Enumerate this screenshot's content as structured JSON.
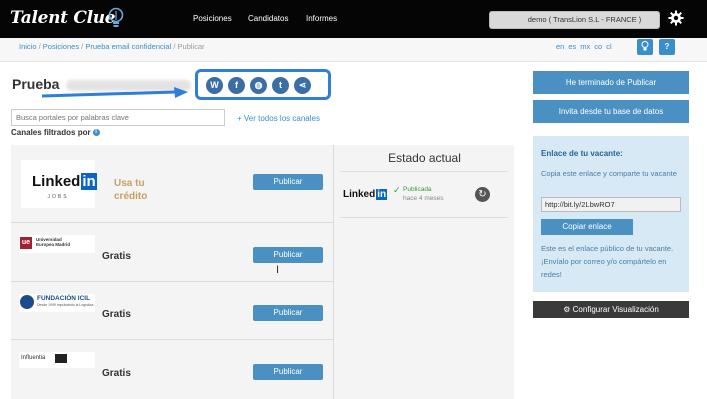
{
  "app": {
    "logo_text": "Talent Clue"
  },
  "nav": {
    "items": [
      "Posiciones",
      "Candidatos",
      "Informes"
    ]
  },
  "account": {
    "label": "demo ( TransLion S.L - FRANCE )"
  },
  "breadcrumb": {
    "items": [
      "Inicio",
      "Posiciones",
      "Prueba email confidencial"
    ],
    "current": "Publicar",
    "separator": "/"
  },
  "languages": [
    "en",
    "es",
    "mx",
    "co",
    "cl"
  ],
  "help_buttons": {
    "bulb": "💡",
    "question": "?"
  },
  "page": {
    "title": "Prueba"
  },
  "share": {
    "icons": [
      {
        "name": "wordpress-icon",
        "glyph": "W"
      },
      {
        "name": "facebook-icon",
        "glyph": "f"
      },
      {
        "name": "globe-icon",
        "glyph": "◍"
      },
      {
        "name": "twitter-icon",
        "glyph": "t"
      },
      {
        "name": "share-icon",
        "glyph": "⋖"
      }
    ]
  },
  "search": {
    "placeholder": "Busca portales por palabras clave"
  },
  "ver_todos": "Ver todos los canales",
  "filtrados_label": "Canales filtrados por",
  "channels": [
    {
      "logo": "LinkedIn",
      "logo_sub": "JOBS",
      "text": "Usa tu crédito",
      "button": "Publicar"
    },
    {
      "logo": "Universidad Europea Madrid",
      "text": "Gratis",
      "button": "Publicar"
    },
    {
      "logo": "FUNDACIÓN ICIL",
      "logo_sub": "Desde 1999 impulsando la Logística",
      "text": "Gratis",
      "button": "Publicar"
    },
    {
      "logo": "Influentia",
      "text": "Gratis",
      "button": "Publicar"
    }
  ],
  "estado": {
    "title": "Estado actual",
    "item": {
      "logo": "Linked",
      "logo_in": "in",
      "status": "Publicada",
      "when": "hace 4 meses"
    }
  },
  "right": {
    "btn_terminado": "He terminado de Publicar",
    "btn_invita": "Invita desde tu base de datos",
    "enlace_title": "Enlace de tu vacante:",
    "enlace_copy": "Copia este enlace y comparte tu vacante",
    "url": "http://bit.ly/2LbwRO7",
    "copiar": "Copiar enlace",
    "enlace_desc": "Este es el enlace público de tu vacante. ¡Envíalo por correo y/o compártelo en redes!",
    "config": "Configurar Visualización"
  },
  "colors": {
    "accent": "#4a90c2",
    "highlight_border": "#2f7ed8",
    "topbar": "#050505"
  }
}
